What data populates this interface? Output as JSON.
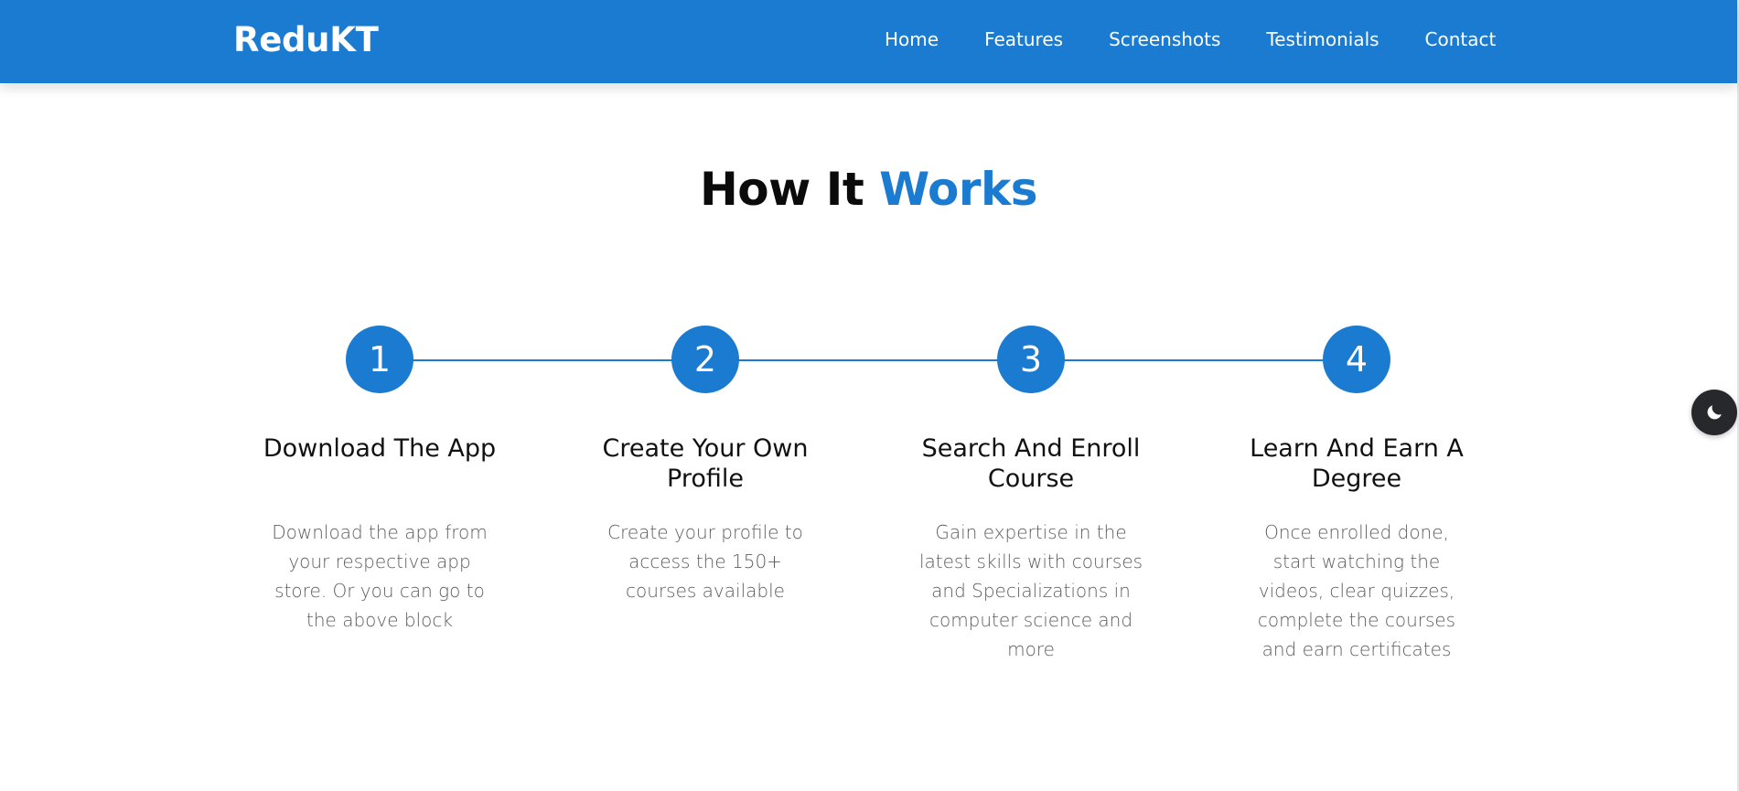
{
  "navbar": {
    "brand": "ReduKT",
    "links": [
      "Home",
      "Features",
      "Screenshots",
      "Testimonials",
      "Contact"
    ]
  },
  "section": {
    "title_main": "How It ",
    "title_accent": "Works"
  },
  "steps": [
    {
      "number": "1",
      "title": "Download The App",
      "description": "Download the app from your respective app store. Or you can go to the above block"
    },
    {
      "number": "2",
      "title": "Create Your Own Profile",
      "description": "Create your profile to access the 150+ courses available"
    },
    {
      "number": "3",
      "title": "Search And Enroll Course",
      "description": "Gain expertise in the latest skills with courses and Specializations in computer science and more"
    },
    {
      "number": "4",
      "title": "Learn And Earn A Degree",
      "description": "Once enrolled done, start watching the videos, clear quizzes, complete the courses and earn certificates"
    }
  ],
  "theme_toggle": {
    "icon": "moon-icon"
  },
  "colors": {
    "brand_blue": "#1a7bd0",
    "heading_dark": "#0b0b0b",
    "text_gray": "#5d5d5d",
    "toggle_dark": "#26282c"
  }
}
